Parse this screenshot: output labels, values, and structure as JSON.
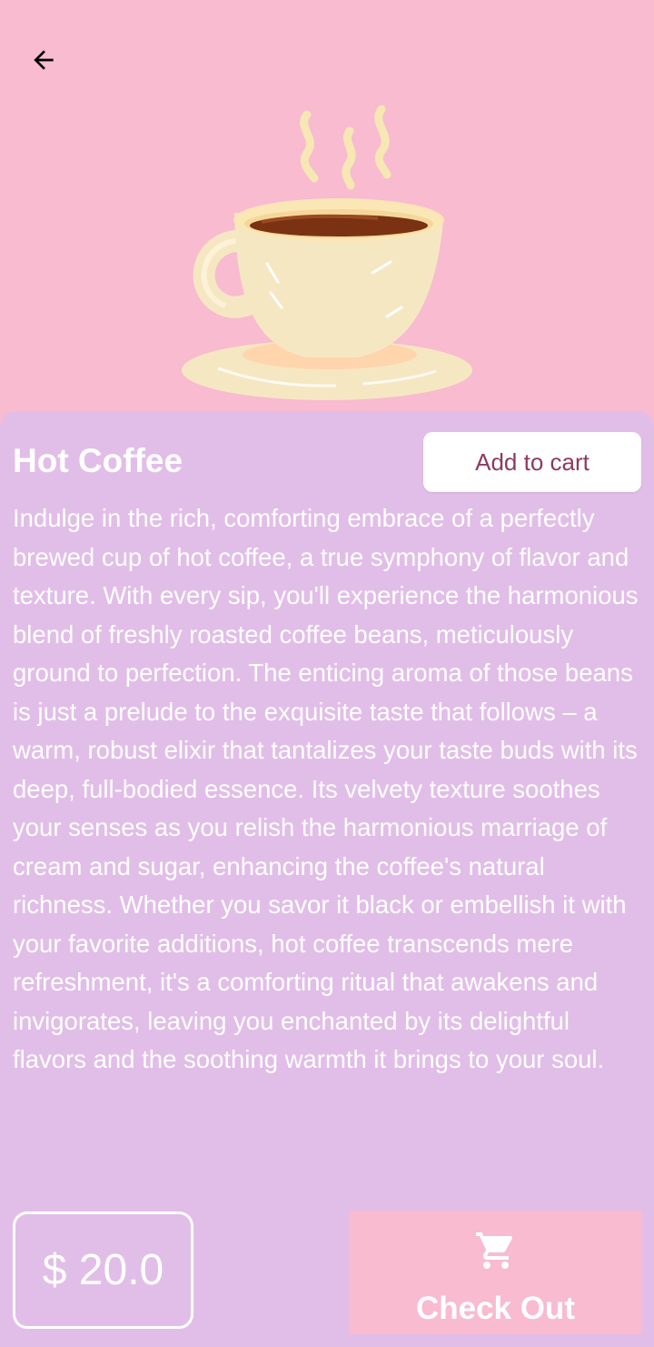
{
  "header": {
    "back_icon": "arrow-left-icon"
  },
  "product": {
    "image_icon": "hot-coffee-cup-illustration",
    "title": "Hot Coffee",
    "add_to_cart_label": "Add to cart",
    "description": "Indulge in the rich, comforting embrace of a perfectly brewed cup of hot coffee, a true symphony of flavor and texture. With every sip, you'll experience the harmonious blend of freshly roasted coffee beans, meticulously ground to perfection. The enticing aroma of those beans is just a prelude to the exquisite taste that follows – a warm, robust elixir that tantalizes your taste buds with its deep, full-bodied essence. Its velvety texture soothes your senses as you relish the harmonious marriage of cream and sugar, enhancing the coffee's natural richness. Whether you savor it black or embellish it with your favorite additions, hot coffee transcends mere refreshment, it's a comforting ritual that awakens and invigorates, leaving you enchanted by its delightful flavors and the soothing warmth it brings to your soul.",
    "price": "$ 20.0"
  },
  "footer": {
    "checkout_label": "Check Out",
    "checkout_icon": "shopping-cart-icon"
  },
  "colors": {
    "background": "#f8bbd0",
    "panel": "#e1bee7",
    "accent_text": "#8e3a62",
    "text": "#ffffff"
  }
}
